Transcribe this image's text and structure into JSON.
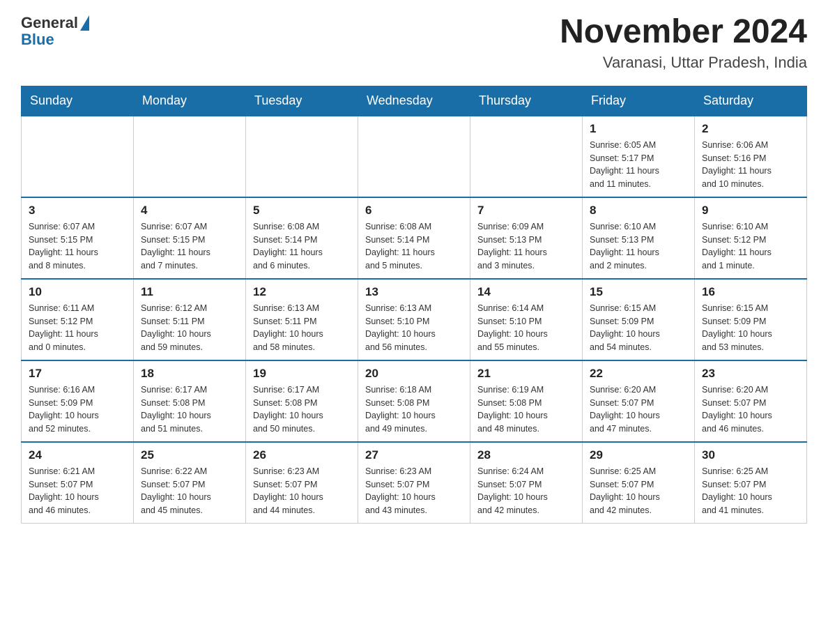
{
  "header": {
    "logo_general": "General",
    "logo_blue": "Blue",
    "month_title": "November 2024",
    "location": "Varanasi, Uttar Pradesh, India"
  },
  "weekdays": [
    "Sunday",
    "Monday",
    "Tuesday",
    "Wednesday",
    "Thursday",
    "Friday",
    "Saturday"
  ],
  "weeks": [
    [
      {
        "day": "",
        "info": ""
      },
      {
        "day": "",
        "info": ""
      },
      {
        "day": "",
        "info": ""
      },
      {
        "day": "",
        "info": ""
      },
      {
        "day": "",
        "info": ""
      },
      {
        "day": "1",
        "info": "Sunrise: 6:05 AM\nSunset: 5:17 PM\nDaylight: 11 hours\nand 11 minutes."
      },
      {
        "day": "2",
        "info": "Sunrise: 6:06 AM\nSunset: 5:16 PM\nDaylight: 11 hours\nand 10 minutes."
      }
    ],
    [
      {
        "day": "3",
        "info": "Sunrise: 6:07 AM\nSunset: 5:15 PM\nDaylight: 11 hours\nand 8 minutes."
      },
      {
        "day": "4",
        "info": "Sunrise: 6:07 AM\nSunset: 5:15 PM\nDaylight: 11 hours\nand 7 minutes."
      },
      {
        "day": "5",
        "info": "Sunrise: 6:08 AM\nSunset: 5:14 PM\nDaylight: 11 hours\nand 6 minutes."
      },
      {
        "day": "6",
        "info": "Sunrise: 6:08 AM\nSunset: 5:14 PM\nDaylight: 11 hours\nand 5 minutes."
      },
      {
        "day": "7",
        "info": "Sunrise: 6:09 AM\nSunset: 5:13 PM\nDaylight: 11 hours\nand 3 minutes."
      },
      {
        "day": "8",
        "info": "Sunrise: 6:10 AM\nSunset: 5:13 PM\nDaylight: 11 hours\nand 2 minutes."
      },
      {
        "day": "9",
        "info": "Sunrise: 6:10 AM\nSunset: 5:12 PM\nDaylight: 11 hours\nand 1 minute."
      }
    ],
    [
      {
        "day": "10",
        "info": "Sunrise: 6:11 AM\nSunset: 5:12 PM\nDaylight: 11 hours\nand 0 minutes."
      },
      {
        "day": "11",
        "info": "Sunrise: 6:12 AM\nSunset: 5:11 PM\nDaylight: 10 hours\nand 59 minutes."
      },
      {
        "day": "12",
        "info": "Sunrise: 6:13 AM\nSunset: 5:11 PM\nDaylight: 10 hours\nand 58 minutes."
      },
      {
        "day": "13",
        "info": "Sunrise: 6:13 AM\nSunset: 5:10 PM\nDaylight: 10 hours\nand 56 minutes."
      },
      {
        "day": "14",
        "info": "Sunrise: 6:14 AM\nSunset: 5:10 PM\nDaylight: 10 hours\nand 55 minutes."
      },
      {
        "day": "15",
        "info": "Sunrise: 6:15 AM\nSunset: 5:09 PM\nDaylight: 10 hours\nand 54 minutes."
      },
      {
        "day": "16",
        "info": "Sunrise: 6:15 AM\nSunset: 5:09 PM\nDaylight: 10 hours\nand 53 minutes."
      }
    ],
    [
      {
        "day": "17",
        "info": "Sunrise: 6:16 AM\nSunset: 5:09 PM\nDaylight: 10 hours\nand 52 minutes."
      },
      {
        "day": "18",
        "info": "Sunrise: 6:17 AM\nSunset: 5:08 PM\nDaylight: 10 hours\nand 51 minutes."
      },
      {
        "day": "19",
        "info": "Sunrise: 6:17 AM\nSunset: 5:08 PM\nDaylight: 10 hours\nand 50 minutes."
      },
      {
        "day": "20",
        "info": "Sunrise: 6:18 AM\nSunset: 5:08 PM\nDaylight: 10 hours\nand 49 minutes."
      },
      {
        "day": "21",
        "info": "Sunrise: 6:19 AM\nSunset: 5:08 PM\nDaylight: 10 hours\nand 48 minutes."
      },
      {
        "day": "22",
        "info": "Sunrise: 6:20 AM\nSunset: 5:07 PM\nDaylight: 10 hours\nand 47 minutes."
      },
      {
        "day": "23",
        "info": "Sunrise: 6:20 AM\nSunset: 5:07 PM\nDaylight: 10 hours\nand 46 minutes."
      }
    ],
    [
      {
        "day": "24",
        "info": "Sunrise: 6:21 AM\nSunset: 5:07 PM\nDaylight: 10 hours\nand 46 minutes."
      },
      {
        "day": "25",
        "info": "Sunrise: 6:22 AM\nSunset: 5:07 PM\nDaylight: 10 hours\nand 45 minutes."
      },
      {
        "day": "26",
        "info": "Sunrise: 6:23 AM\nSunset: 5:07 PM\nDaylight: 10 hours\nand 44 minutes."
      },
      {
        "day": "27",
        "info": "Sunrise: 6:23 AM\nSunset: 5:07 PM\nDaylight: 10 hours\nand 43 minutes."
      },
      {
        "day": "28",
        "info": "Sunrise: 6:24 AM\nSunset: 5:07 PM\nDaylight: 10 hours\nand 42 minutes."
      },
      {
        "day": "29",
        "info": "Sunrise: 6:25 AM\nSunset: 5:07 PM\nDaylight: 10 hours\nand 42 minutes."
      },
      {
        "day": "30",
        "info": "Sunrise: 6:25 AM\nSunset: 5:07 PM\nDaylight: 10 hours\nand 41 minutes."
      }
    ]
  ]
}
